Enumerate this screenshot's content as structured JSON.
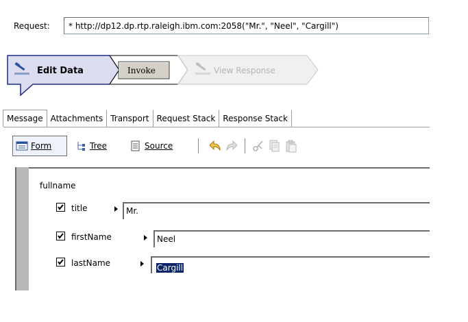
{
  "request": {
    "label": "Request:",
    "value": "* http://dp12.dp.rtp.raleigh.ibm.com:2058(\"Mr.\", \"Neel\", \"Cargill\")"
  },
  "steps": {
    "edit_data": "Edit Data",
    "invoke": "Invoke",
    "view_response": "View Response"
  },
  "tabs": [
    "Message",
    "Attachments",
    "Transport",
    "Request Stack",
    "Response Stack"
  ],
  "toolbar": {
    "form_label": "Form",
    "tree_label": "Tree",
    "source_label": "Source"
  },
  "form": {
    "group_label": "fullname",
    "fields": [
      {
        "label": "title",
        "value": "Mr.",
        "checked": true
      },
      {
        "label": "firstName",
        "value": "Neel",
        "checked": true
      },
      {
        "label": "lastName",
        "value": "Cargill",
        "checked": true
      }
    ]
  }
}
